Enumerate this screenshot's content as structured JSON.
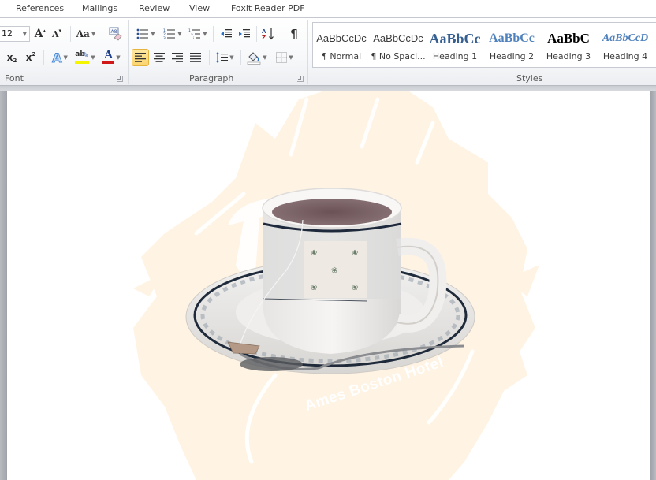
{
  "tabs": [
    {
      "label": "References"
    },
    {
      "label": "Mailings"
    },
    {
      "label": "Review"
    },
    {
      "label": "View"
    },
    {
      "label": "Foxit Reader PDF"
    }
  ],
  "font_group": {
    "label": "Font",
    "font_size": "12",
    "grow_font": "A",
    "shrink_font": "A",
    "change_case": "Aa",
    "subscript": "x",
    "superscript": "x",
    "text_effects": "A",
    "highlight": "ab",
    "font_color": "A",
    "highlight_color": "#f5f500",
    "font_color_value": "#d01818"
  },
  "paragraph_group": {
    "label": "Paragraph",
    "show_hide": "¶",
    "active_alignment": "align-left"
  },
  "styles_group": {
    "label": "Styles",
    "items": [
      {
        "sample": "AaBbCcDc",
        "name": "¶ Normal",
        "color": "#000000"
      },
      {
        "sample": "AaBbCcDc",
        "name": "¶ No Spaci...",
        "color": "#000000"
      },
      {
        "sample": "AaBbCc",
        "name": "Heading 1",
        "color": "#365f91"
      },
      {
        "sample": "AaBbCc",
        "name": "Heading 2",
        "color": "#4f81bd"
      },
      {
        "sample": "AaBbC",
        "name": "Heading 3",
        "color": "#000000"
      },
      {
        "sample": "AaBbCcD",
        "name": "Heading 4",
        "color": "#4f81bd"
      }
    ]
  },
  "document": {
    "watermark_text": "Ames Boston Hotel",
    "watermark_color": "#fff3e3",
    "image_subject": "teacup-on-saucer"
  }
}
